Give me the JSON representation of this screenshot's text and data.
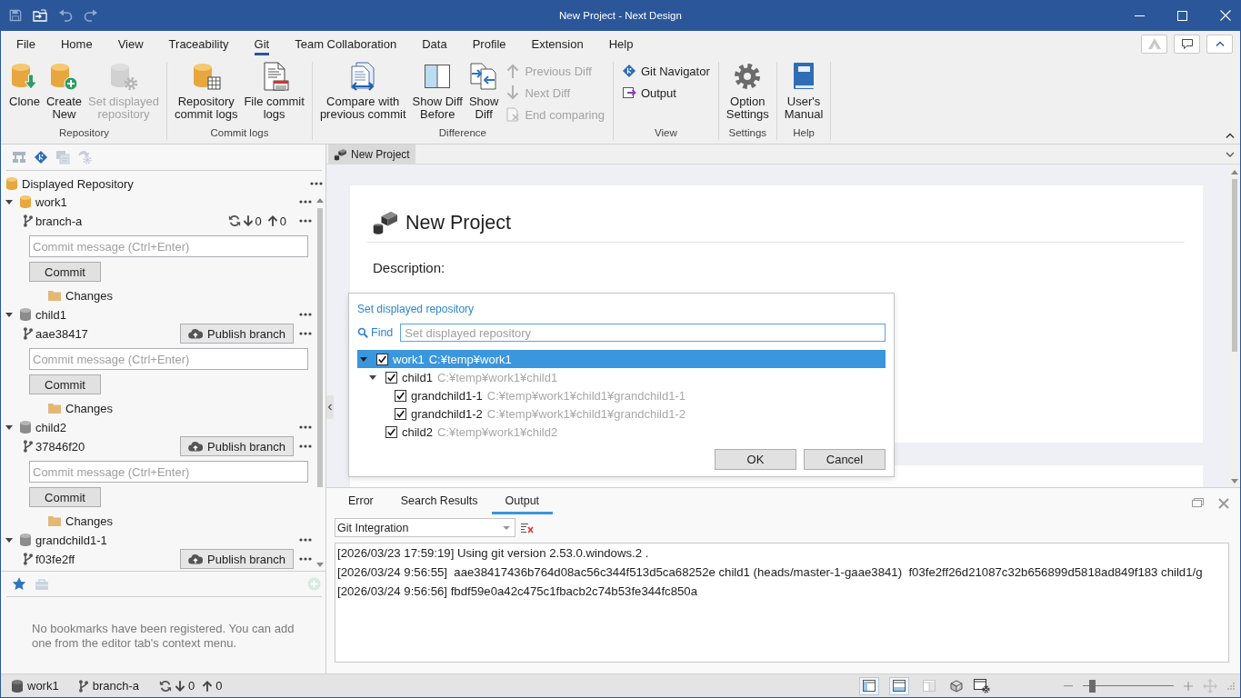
{
  "title_bar": {
    "title": "New Project - Next Design"
  },
  "ribbon": {
    "tabs": [
      {
        "label": "File",
        "selected": false
      },
      {
        "label": "Home",
        "selected": false
      },
      {
        "label": "View",
        "selected": false
      },
      {
        "label": "Traceability",
        "selected": false
      },
      {
        "label": "Git",
        "selected": true
      },
      {
        "label": "Team Collaboration",
        "selected": false
      },
      {
        "label": "Data",
        "selected": false
      },
      {
        "label": "Profile",
        "selected": false
      },
      {
        "label": "Extension",
        "selected": false
      },
      {
        "label": "Help",
        "selected": false
      }
    ],
    "groups": [
      {
        "label": "Repository",
        "items": [
          {
            "kind": "large",
            "label": "Clone",
            "disabled": false
          },
          {
            "kind": "large",
            "label": "Create\nNew",
            "disabled": false
          },
          {
            "kind": "large",
            "label": "Set displayed\nrepository",
            "disabled": true
          }
        ]
      },
      {
        "label": "Commit logs",
        "items": [
          {
            "kind": "large",
            "label": "Repository\ncommit logs",
            "disabled": false
          },
          {
            "kind": "large",
            "label": "File commit\nlogs",
            "disabled": false
          }
        ]
      },
      {
        "label": "Difference",
        "items": [
          {
            "kind": "large",
            "label": "Compare with\nprevious commit",
            "disabled": false
          },
          {
            "kind": "large",
            "label": "Show Diff\nBefore",
            "disabled": false
          },
          {
            "kind": "large",
            "label": "Show\nDiff",
            "disabled": false
          },
          {
            "kind": "small",
            "label": "Previous Diff",
            "disabled": true
          },
          {
            "kind": "small",
            "label": "Next Diff",
            "disabled": true
          },
          {
            "kind": "small",
            "label": "End comparing",
            "disabled": true
          }
        ]
      },
      {
        "label": "View",
        "items": [
          {
            "kind": "small",
            "label": "Git Navigator",
            "disabled": false
          },
          {
            "kind": "small",
            "label": "Output",
            "disabled": false
          }
        ]
      },
      {
        "label": "Settings",
        "items": [
          {
            "kind": "large",
            "label": "Option\nSettings",
            "disabled": false
          }
        ]
      },
      {
        "label": "Help",
        "items": [
          {
            "kind": "large",
            "label": "User's\nManual",
            "disabled": false
          }
        ]
      }
    ]
  },
  "navigator": {
    "header": "Displayed Repository",
    "repositories": [
      {
        "kind": "main",
        "name": "work1",
        "expanded": true,
        "branch": "branch-a",
        "behind": "0",
        "ahead": "0",
        "commit": {
          "placeholder": "Commit message (Ctrl+Enter)",
          "button": "Commit"
        },
        "changes": "Changes"
      },
      {
        "kind": "submodule",
        "name": "child1",
        "expanded": true,
        "branch": "aae38417",
        "publish": "Publish branch",
        "commit": {
          "placeholder": "Commit message (Ctrl+Enter)",
          "button": "Commit"
        },
        "changes": "Changes"
      },
      {
        "kind": "submodule",
        "name": "child2",
        "expanded": true,
        "branch": "37846f20",
        "publish": "Publish branch",
        "commit": {
          "placeholder": "Commit message (Ctrl+Enter)",
          "button": "Commit"
        },
        "changes": "Changes"
      },
      {
        "kind": "submodule",
        "name": "grandchild1-1",
        "expanded": true,
        "branch": "f03fe2ff",
        "publish": "Publish branch"
      }
    ]
  },
  "bookmarks": {
    "message": "No bookmarks have been registered. You can add one from the editor tab's context menu."
  },
  "document_tabs": [
    {
      "label": "New Project",
      "selected": true
    }
  ],
  "editor": {
    "title": "New Project",
    "description_label": "Description:"
  },
  "dialog": {
    "title": "Set displayed repository",
    "find_label": "Find",
    "search": {
      "placeholder": "Set displayed repository"
    },
    "tree": [
      {
        "name": "work1",
        "path": "C:¥temp¥work1",
        "checked": true,
        "selected": true,
        "expanded": true,
        "children": [
          {
            "name": "child1",
            "path": "C:¥temp¥work1¥child1",
            "checked": true,
            "selected": false,
            "expanded": true,
            "children": [
              {
                "name": "grandchild1-1",
                "path": "C:¥temp¥work1¥child1¥grandchild1-1",
                "checked": true,
                "selected": false
              },
              {
                "name": "grandchild1-2",
                "path": "C:¥temp¥work1¥child1¥grandchild1-2",
                "checked": true,
                "selected": false
              }
            ]
          },
          {
            "name": "child2",
            "path": "C:¥temp¥work1¥child2",
            "checked": true,
            "selected": false
          }
        ]
      }
    ],
    "buttons": [
      "OK",
      "Cancel"
    ]
  },
  "output_panel": {
    "tabs": [
      {
        "label": "Error",
        "selected": false
      },
      {
        "label": "Search Results",
        "selected": false
      },
      {
        "label": "Output",
        "selected": true
      }
    ],
    "source": {
      "value": "Git Integration"
    },
    "lines": [
      "[2026/03/23 17:59:19] Using git version 2.53.0.windows.2 .",
      "[2026/03/24 9:56:55]  aae38417436b764d08ac56c344f513d5ca68252e child1 (heads/master-1-gaae3841)  f03fe2ff26d21087c32b656899d5818ad849f183 child1/g",
      "[2026/03/24 9:56:56] fbdf59e0a42c475c1fbacb2c74b53fe344fc850a"
    ]
  },
  "status_bar": {
    "repository": "work1",
    "branch": "branch-a",
    "behind": "0",
    "ahead": "0",
    "panel_toggles": [
      {
        "on": true
      },
      {
        "on": true
      },
      {
        "on": false
      }
    ],
    "zoom": {
      "level": 0.08
    }
  }
}
